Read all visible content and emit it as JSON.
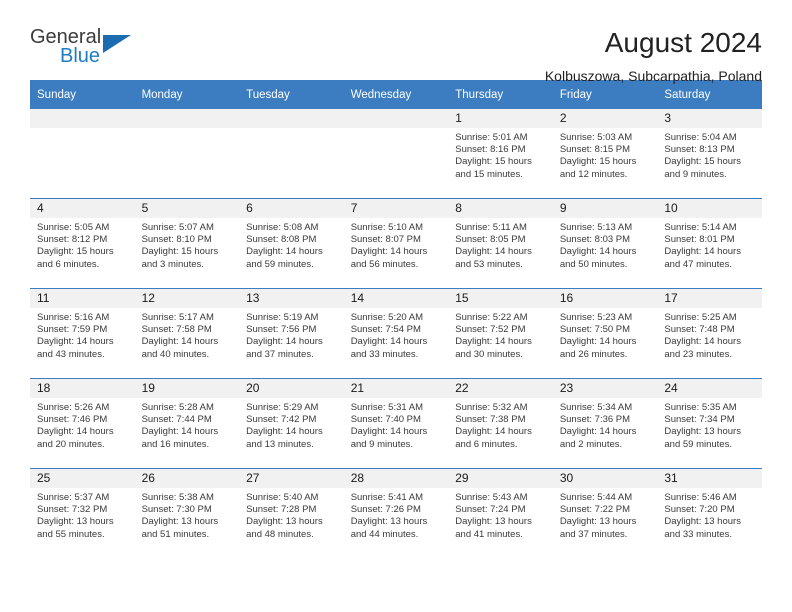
{
  "brand": {
    "name_top": "General",
    "name_bottom": "Blue",
    "triangle_color": "#1b6cb0",
    "blue_text_color": "#1d7cc4"
  },
  "header": {
    "title": "August 2024",
    "subtitle": "Kolbuszowa, Subcarpathia, Poland"
  },
  "theme": {
    "header_bg": "#3b7dc0",
    "daynum_bg": "#f1f1f1",
    "grid_line": "#3b7dc0"
  },
  "weekdays": [
    "Sunday",
    "Monday",
    "Tuesday",
    "Wednesday",
    "Thursday",
    "Friday",
    "Saturday"
  ],
  "labels": {
    "sunrise_prefix": "Sunrise:",
    "sunset_prefix": "Sunset:",
    "daylight_prefix": "Daylight:"
  },
  "weeks": [
    [
      {
        "day": "",
        "empty": true
      },
      {
        "day": "",
        "empty": true
      },
      {
        "day": "",
        "empty": true
      },
      {
        "day": "",
        "empty": true
      },
      {
        "day": "1",
        "sunrise": "Sunrise: 5:01 AM",
        "sunset": "Sunset: 8:16 PM",
        "daylight_1": "Daylight: 15 hours",
        "daylight_2": "and 15 minutes."
      },
      {
        "day": "2",
        "sunrise": "Sunrise: 5:03 AM",
        "sunset": "Sunset: 8:15 PM",
        "daylight_1": "Daylight: 15 hours",
        "daylight_2": "and 12 minutes."
      },
      {
        "day": "3",
        "sunrise": "Sunrise: 5:04 AM",
        "sunset": "Sunset: 8:13 PM",
        "daylight_1": "Daylight: 15 hours",
        "daylight_2": "and 9 minutes."
      }
    ],
    [
      {
        "day": "4",
        "sunrise": "Sunrise: 5:05 AM",
        "sunset": "Sunset: 8:12 PM",
        "daylight_1": "Daylight: 15 hours",
        "daylight_2": "and 6 minutes."
      },
      {
        "day": "5",
        "sunrise": "Sunrise: 5:07 AM",
        "sunset": "Sunset: 8:10 PM",
        "daylight_1": "Daylight: 15 hours",
        "daylight_2": "and 3 minutes."
      },
      {
        "day": "6",
        "sunrise": "Sunrise: 5:08 AM",
        "sunset": "Sunset: 8:08 PM",
        "daylight_1": "Daylight: 14 hours",
        "daylight_2": "and 59 minutes."
      },
      {
        "day": "7",
        "sunrise": "Sunrise: 5:10 AM",
        "sunset": "Sunset: 8:07 PM",
        "daylight_1": "Daylight: 14 hours",
        "daylight_2": "and 56 minutes."
      },
      {
        "day": "8",
        "sunrise": "Sunrise: 5:11 AM",
        "sunset": "Sunset: 8:05 PM",
        "daylight_1": "Daylight: 14 hours",
        "daylight_2": "and 53 minutes."
      },
      {
        "day": "9",
        "sunrise": "Sunrise: 5:13 AM",
        "sunset": "Sunset: 8:03 PM",
        "daylight_1": "Daylight: 14 hours",
        "daylight_2": "and 50 minutes."
      },
      {
        "day": "10",
        "sunrise": "Sunrise: 5:14 AM",
        "sunset": "Sunset: 8:01 PM",
        "daylight_1": "Daylight: 14 hours",
        "daylight_2": "and 47 minutes."
      }
    ],
    [
      {
        "day": "11",
        "sunrise": "Sunrise: 5:16 AM",
        "sunset": "Sunset: 7:59 PM",
        "daylight_1": "Daylight: 14 hours",
        "daylight_2": "and 43 minutes."
      },
      {
        "day": "12",
        "sunrise": "Sunrise: 5:17 AM",
        "sunset": "Sunset: 7:58 PM",
        "daylight_1": "Daylight: 14 hours",
        "daylight_2": "and 40 minutes."
      },
      {
        "day": "13",
        "sunrise": "Sunrise: 5:19 AM",
        "sunset": "Sunset: 7:56 PM",
        "daylight_1": "Daylight: 14 hours",
        "daylight_2": "and 37 minutes."
      },
      {
        "day": "14",
        "sunrise": "Sunrise: 5:20 AM",
        "sunset": "Sunset: 7:54 PM",
        "daylight_1": "Daylight: 14 hours",
        "daylight_2": "and 33 minutes."
      },
      {
        "day": "15",
        "sunrise": "Sunrise: 5:22 AM",
        "sunset": "Sunset: 7:52 PM",
        "daylight_1": "Daylight: 14 hours",
        "daylight_2": "and 30 minutes."
      },
      {
        "day": "16",
        "sunrise": "Sunrise: 5:23 AM",
        "sunset": "Sunset: 7:50 PM",
        "daylight_1": "Daylight: 14 hours",
        "daylight_2": "and 26 minutes."
      },
      {
        "day": "17",
        "sunrise": "Sunrise: 5:25 AM",
        "sunset": "Sunset: 7:48 PM",
        "daylight_1": "Daylight: 14 hours",
        "daylight_2": "and 23 minutes."
      }
    ],
    [
      {
        "day": "18",
        "sunrise": "Sunrise: 5:26 AM",
        "sunset": "Sunset: 7:46 PM",
        "daylight_1": "Daylight: 14 hours",
        "daylight_2": "and 20 minutes."
      },
      {
        "day": "19",
        "sunrise": "Sunrise: 5:28 AM",
        "sunset": "Sunset: 7:44 PM",
        "daylight_1": "Daylight: 14 hours",
        "daylight_2": "and 16 minutes."
      },
      {
        "day": "20",
        "sunrise": "Sunrise: 5:29 AM",
        "sunset": "Sunset: 7:42 PM",
        "daylight_1": "Daylight: 14 hours",
        "daylight_2": "and 13 minutes."
      },
      {
        "day": "21",
        "sunrise": "Sunrise: 5:31 AM",
        "sunset": "Sunset: 7:40 PM",
        "daylight_1": "Daylight: 14 hours",
        "daylight_2": "and 9 minutes."
      },
      {
        "day": "22",
        "sunrise": "Sunrise: 5:32 AM",
        "sunset": "Sunset: 7:38 PM",
        "daylight_1": "Daylight: 14 hours",
        "daylight_2": "and 6 minutes."
      },
      {
        "day": "23",
        "sunrise": "Sunrise: 5:34 AM",
        "sunset": "Sunset: 7:36 PM",
        "daylight_1": "Daylight: 14 hours",
        "daylight_2": "and 2 minutes."
      },
      {
        "day": "24",
        "sunrise": "Sunrise: 5:35 AM",
        "sunset": "Sunset: 7:34 PM",
        "daylight_1": "Daylight: 13 hours",
        "daylight_2": "and 59 minutes."
      }
    ],
    [
      {
        "day": "25",
        "sunrise": "Sunrise: 5:37 AM",
        "sunset": "Sunset: 7:32 PM",
        "daylight_1": "Daylight: 13 hours",
        "daylight_2": "and 55 minutes."
      },
      {
        "day": "26",
        "sunrise": "Sunrise: 5:38 AM",
        "sunset": "Sunset: 7:30 PM",
        "daylight_1": "Daylight: 13 hours",
        "daylight_2": "and 51 minutes."
      },
      {
        "day": "27",
        "sunrise": "Sunrise: 5:40 AM",
        "sunset": "Sunset: 7:28 PM",
        "daylight_1": "Daylight: 13 hours",
        "daylight_2": "and 48 minutes."
      },
      {
        "day": "28",
        "sunrise": "Sunrise: 5:41 AM",
        "sunset": "Sunset: 7:26 PM",
        "daylight_1": "Daylight: 13 hours",
        "daylight_2": "and 44 minutes."
      },
      {
        "day": "29",
        "sunrise": "Sunrise: 5:43 AM",
        "sunset": "Sunset: 7:24 PM",
        "daylight_1": "Daylight: 13 hours",
        "daylight_2": "and 41 minutes."
      },
      {
        "day": "30",
        "sunrise": "Sunrise: 5:44 AM",
        "sunset": "Sunset: 7:22 PM",
        "daylight_1": "Daylight: 13 hours",
        "daylight_2": "and 37 minutes."
      },
      {
        "day": "31",
        "sunrise": "Sunrise: 5:46 AM",
        "sunset": "Sunset: 7:20 PM",
        "daylight_1": "Daylight: 13 hours",
        "daylight_2": "and 33 minutes."
      }
    ]
  ]
}
